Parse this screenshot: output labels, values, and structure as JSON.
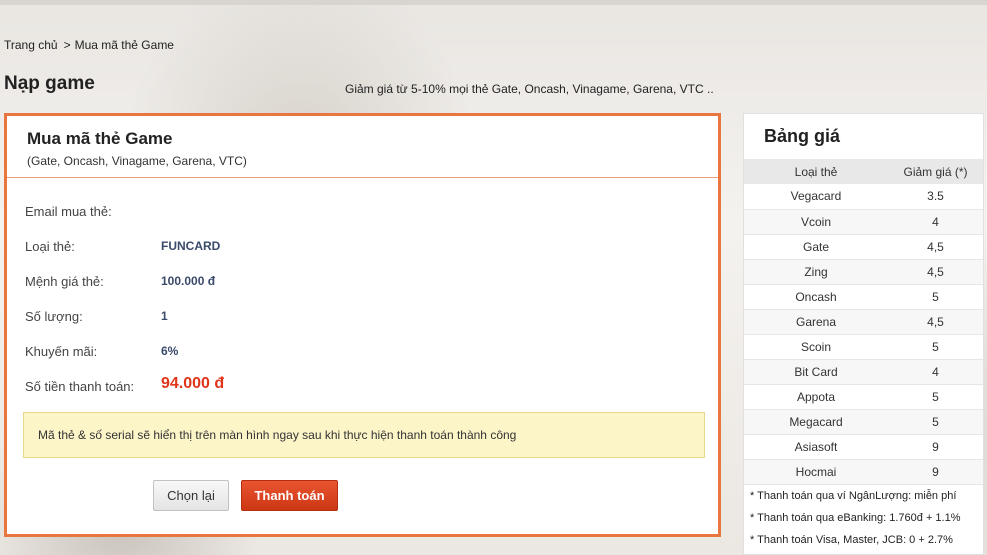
{
  "breadcrumb": {
    "home": "Trang chủ",
    "separator": ">",
    "current": "Mua mã thẻ Game"
  },
  "page_title": "Nạp game",
  "promo": "Giảm giá từ 5-10% mọi thẻ Gate, Oncash, Vinagame, Garena, VTC ..",
  "panel": {
    "title": "Mua mã thẻ Game",
    "subtitle": "(Gate, Oncash, Vinagame, Garena, VTC)"
  },
  "form": {
    "email": {
      "label": "Email mua thẻ:",
      "value": ""
    },
    "card_type": {
      "label": "Loại thẻ:",
      "value": "FUNCARD"
    },
    "denomination": {
      "label": "Mệnh giá thẻ:",
      "value": "100.000 đ"
    },
    "quantity": {
      "label": "Số lượng:",
      "value": "1"
    },
    "promotion": {
      "label": "Khuyến mãi:",
      "value": "6%"
    },
    "total": {
      "label": "Số tiền thanh toán:",
      "value": "94.000 đ"
    }
  },
  "notice": "Mã thẻ & số serial sẽ hiển thị trên màn hình ngay sau khi thực hiện thanh toán thành công",
  "buttons": {
    "back": "Chọn lại",
    "pay": "Thanh toán"
  },
  "price_table": {
    "title": "Bảng giá",
    "headers": [
      "Loại thẻ",
      "Giảm giá (*)"
    ],
    "rows": [
      [
        "Vegacard",
        "3.5"
      ],
      [
        "Vcoin",
        "4"
      ],
      [
        "Gate",
        "4,5"
      ],
      [
        "Zing",
        "4,5"
      ],
      [
        "Oncash",
        "5"
      ],
      [
        "Garena",
        "4,5"
      ],
      [
        "Scoin",
        "5"
      ],
      [
        "Bit Card",
        "4"
      ],
      [
        "Appota",
        "5"
      ],
      [
        "Megacard",
        "5"
      ],
      [
        "Asiasoft",
        "9"
      ],
      [
        "Hocmai",
        "9"
      ]
    ],
    "notes": [
      "* Thanh toán qua ví NgânLượng: miễn phí",
      "* Thanh toán qua eBanking: 1.760đ + 1.1%",
      "* Thanh toán Visa, Master, JCB: 0 + 2.7%"
    ]
  },
  "colors": {
    "accent": "#e8763e",
    "pay_button": "#d8401c",
    "total": "#e0351a",
    "notice_bg": "#fcf5c8"
  }
}
